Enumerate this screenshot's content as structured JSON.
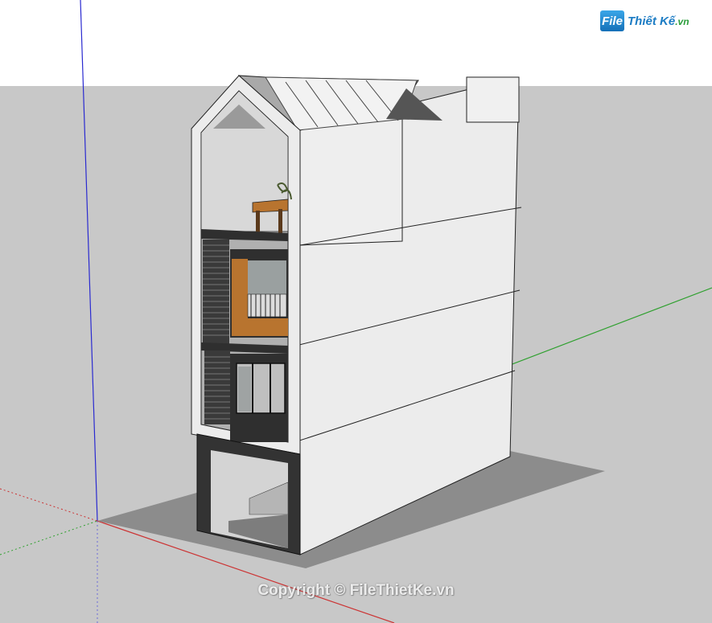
{
  "app": {
    "scene": "sketchup-viewport"
  },
  "brand": {
    "mark": "File",
    "name": "Thiết Kế",
    "suffix": ".vn"
  },
  "watermark": {
    "text": "Copyright © FileThietKe.vn"
  },
  "colors": {
    "sky": "#ffffff",
    "ground": "#c8c8c8",
    "shadow": "#8c8c8c",
    "wall": "#ececec",
    "dark": "#333333",
    "wood": "#b8742f",
    "axis_red": "#cc3333",
    "axis_green": "#2ea02e",
    "axis_blue": "#2a2ad0"
  }
}
